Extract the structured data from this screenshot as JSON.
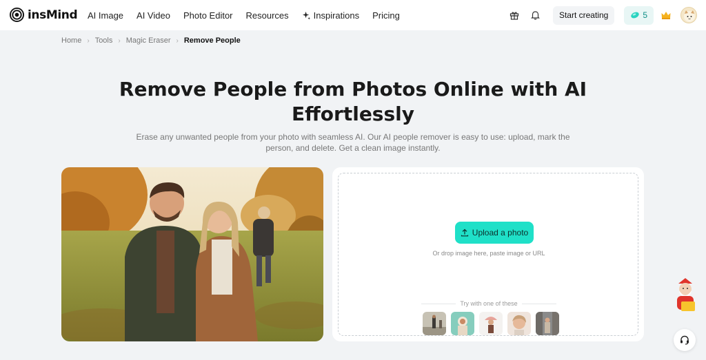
{
  "brand": {
    "name": "insMind"
  },
  "nav": {
    "items": [
      {
        "label": "AI Image"
      },
      {
        "label": "AI Video"
      },
      {
        "label": "Photo Editor"
      },
      {
        "label": "Resources"
      },
      {
        "label": "Inspirations",
        "icon": "sparkle-icon"
      },
      {
        "label": "Pricing"
      }
    ]
  },
  "header": {
    "start_label": "Start creating",
    "credits": "5",
    "icons": [
      "gift-icon",
      "bell-icon",
      "gem-icon",
      "crown-icon"
    ]
  },
  "breadcrumb": {
    "items": [
      "Home",
      "Tools",
      "Magic Eraser"
    ],
    "current": "Remove People"
  },
  "hero": {
    "title": "Remove People from Photos Online with AI Effortlessly",
    "subtitle": "Erase any unwanted people from your photo with seamless AI. Our AI people remover is easy to use: upload, mark the person, and delete. Get a clean image instantly."
  },
  "upload": {
    "button_label": "Upload a photo",
    "hint": "Or drop image here, paste image or URL",
    "try_label": "Try with one of these",
    "samples": [
      "sample-1",
      "sample-2",
      "sample-3",
      "sample-4",
      "sample-5"
    ]
  },
  "colors": {
    "accent": "#1fe0c8",
    "background": "#f1f3f5",
    "card": "#ffffff",
    "text_muted": "#777777"
  }
}
